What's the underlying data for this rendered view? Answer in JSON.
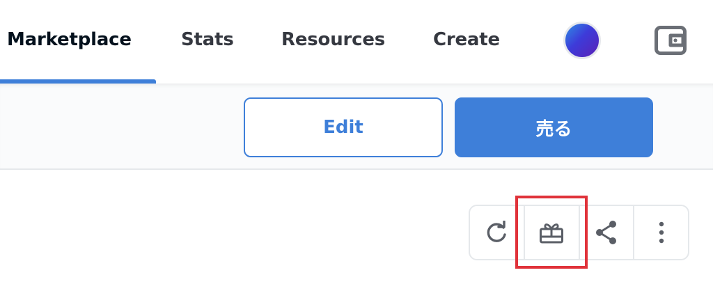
{
  "nav": {
    "items": [
      {
        "label": "Marketplace",
        "active": true
      },
      {
        "label": "Stats",
        "active": false
      },
      {
        "label": "Resources",
        "active": false
      },
      {
        "label": "Create",
        "active": false
      }
    ],
    "avatar_icon": "profile-avatar",
    "wallet_icon": "wallet-icon"
  },
  "actions": {
    "edit_label": "Edit",
    "sell_label": "売る"
  },
  "icon_toolbar": {
    "items": [
      {
        "icon": "refresh-icon"
      },
      {
        "icon": "gift-icon",
        "highlighted": true
      },
      {
        "icon": "share-icon"
      },
      {
        "icon": "more-vertical-icon"
      }
    ]
  },
  "colors": {
    "accent": "#3e7fd9",
    "text_primary": "#04111d",
    "text_secondary": "#353840",
    "highlight": "#e0323a",
    "border": "#e5e8eb"
  }
}
